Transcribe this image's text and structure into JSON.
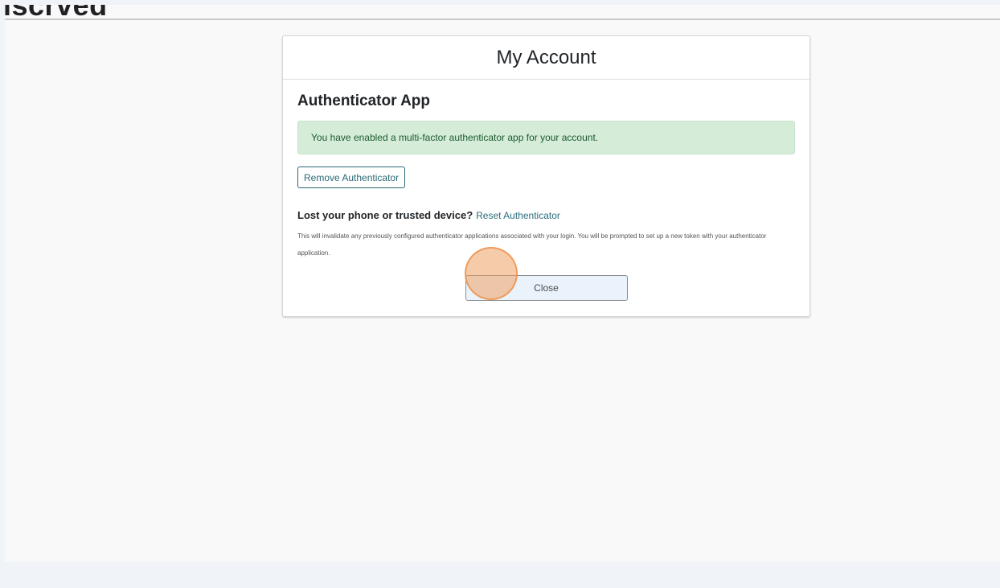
{
  "background_page": {
    "title_fragment": "iscrved"
  },
  "modal": {
    "title": "My Account",
    "section_title": "Authenticator App",
    "alert_text": "You have enabled a multi-factor authenticator app for your account.",
    "remove_button_label": "Remove Authenticator",
    "lost_heading": "Lost your phone or trusted device?",
    "reset_link_label": "Reset Authenticator",
    "note_text": "This will invalidate any previously configured authenticator applications associated with your login. You will be prompted to set up a new token with your authenticator application.",
    "close_button_label": "Close"
  },
  "colors": {
    "alert_background": "#d4ecd8",
    "alert_text": "#1d5b2f",
    "accent": "#2a6874",
    "click_marker": "#efa064"
  }
}
